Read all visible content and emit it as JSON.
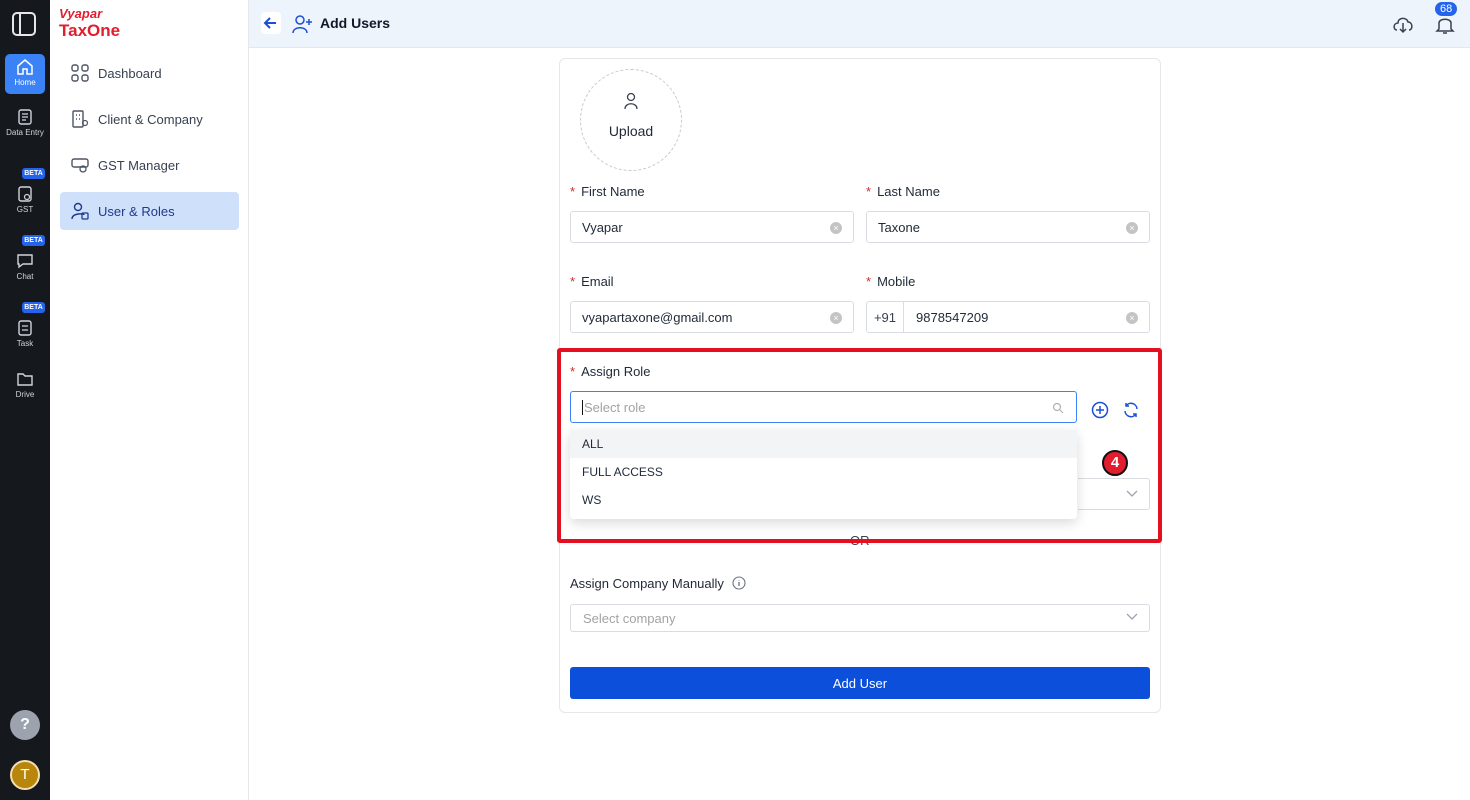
{
  "rail": {
    "items": [
      {
        "label": "Home"
      },
      {
        "label": "Data Entry"
      },
      {
        "label": "GST",
        "badge": "BETA"
      },
      {
        "label": "Chat",
        "badge": "BETA"
      },
      {
        "label": "Task",
        "badge": "BETA"
      },
      {
        "label": "Drive"
      }
    ],
    "help": "?",
    "avatar_initial": "T"
  },
  "brand": {
    "top": "Vyapar",
    "bottom": "TaxOne",
    "color": "#e11d2e"
  },
  "sidebar": {
    "items": [
      {
        "label": "Dashboard",
        "icon": "grid-icon"
      },
      {
        "label": "Client & Company",
        "icon": "building-icon"
      },
      {
        "label": "GST Manager",
        "icon": "gst-icon"
      },
      {
        "label": "User & Roles",
        "icon": "user-roles-icon",
        "active": true
      }
    ]
  },
  "header": {
    "title": "Add Users",
    "notification_count": "68"
  },
  "form": {
    "upload_label": "Upload",
    "first_name": {
      "label": "First Name",
      "value": "Vyapar"
    },
    "last_name": {
      "label": "Last Name",
      "value": "Taxone"
    },
    "email": {
      "label": "Email",
      "value": "vyapartaxone@gmail.com"
    },
    "mobile": {
      "label": "Mobile",
      "prefix": "+91",
      "value": "9878547209"
    },
    "assign_role": {
      "label": "Assign Role",
      "placeholder": "Select role",
      "options": [
        "ALL",
        "FULL ACCESS",
        "WS"
      ]
    },
    "step_marker": "4",
    "or_text": "OR",
    "assign_company": {
      "label": "Assign Company Manually",
      "placeholder": "Select company"
    },
    "submit_label": "Add User"
  },
  "colors": {
    "accent": "#0b4fdb",
    "highlight": "#e5101f",
    "required": "#dc2626"
  }
}
